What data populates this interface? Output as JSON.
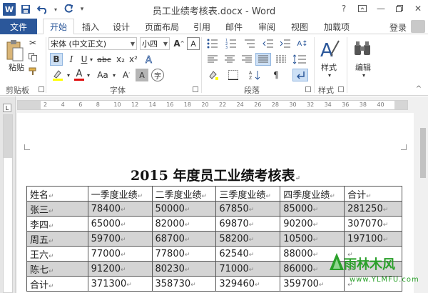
{
  "titlebar": {
    "title": "员工业绩考核表.docx - Word",
    "help": "?",
    "window_controls": [
      "restore",
      "minimize",
      "maximize",
      "close"
    ]
  },
  "tabs": {
    "file": "文件",
    "items": [
      "开始",
      "插入",
      "设计",
      "页面布局",
      "引用",
      "邮件",
      "审阅",
      "视图",
      "加载项"
    ],
    "active": "开始",
    "login": "登录"
  },
  "ribbon": {
    "clipboard": {
      "paste": "粘贴",
      "label": "剪贴板"
    },
    "font": {
      "font_name": "宋体 (中文正文)",
      "font_size": "小四",
      "bold": "B",
      "italic": "I",
      "underline": "U",
      "strike": "abc",
      "sub": "x₂",
      "sup": "x²",
      "font_color": "A",
      "change_case": "Aa",
      "label": "字体"
    },
    "paragraph": {
      "label": "段落"
    },
    "styles": {
      "btn": "样式",
      "label": "样式"
    },
    "editing": {
      "btn": "编辑"
    }
  },
  "ruler_marks": [
    "2",
    "4",
    "6",
    "8",
    "10",
    "12",
    "14",
    "16",
    "18",
    "20",
    "22",
    "24",
    "26",
    "28",
    "30",
    "32",
    "34",
    "36",
    "38",
    "40"
  ],
  "document": {
    "heading": "2015 年度员工业绩考核表",
    "table": {
      "headers": [
        "姓名",
        "一季度业绩",
        "二季度业绩",
        "三季度业绩",
        "四季度业绩",
        "合计"
      ],
      "rows": [
        [
          "张三",
          "78400",
          "50000",
          "67850",
          "85000",
          "281250"
        ],
        [
          "李四",
          "65000",
          "82000",
          "69870",
          "90200",
          "307070"
        ],
        [
          "周五",
          "59700",
          "68700",
          "58200",
          "10500",
          "197100"
        ],
        [
          "王六",
          "77000",
          "77800",
          "62540",
          "88000",
          ""
        ],
        [
          "陈七",
          "91200",
          "80230",
          "71000",
          "86000",
          ""
        ],
        [
          "合计",
          "371300",
          "358730",
          "329460",
          "359700",
          ""
        ]
      ],
      "shaded_rows": [
        0,
        2,
        4
      ]
    }
  },
  "watermark": {
    "main": "雨林木风",
    "sub": "www.YLMFU.com"
  },
  "colors": {
    "accent": "#2b579a",
    "shade": "#d4d4d4"
  }
}
